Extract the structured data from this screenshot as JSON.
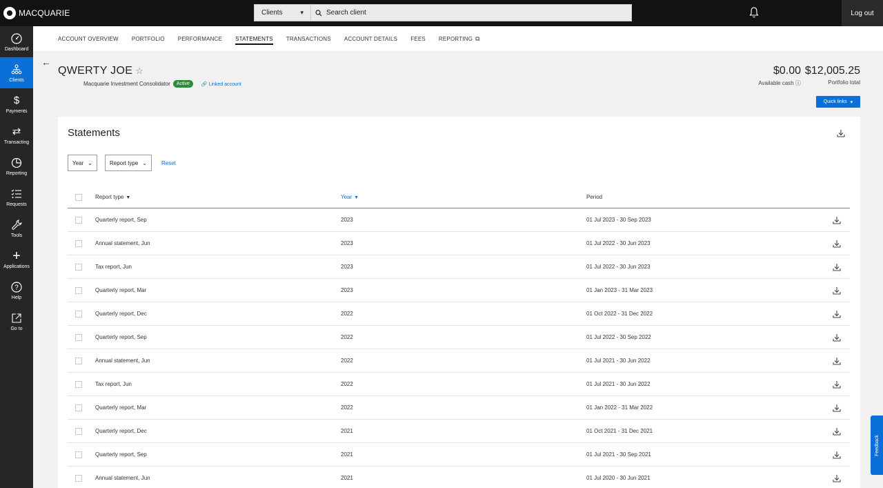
{
  "brand": {
    "name": "MACQUARIE"
  },
  "search": {
    "scope": "Clients",
    "placeholder": "Search client"
  },
  "top": {
    "logout": "Log out"
  },
  "sidenav": [
    {
      "label": "Dashboard",
      "icon": "dashboard-icon",
      "active": false
    },
    {
      "label": "Clients",
      "icon": "clients-icon",
      "active": true
    },
    {
      "label": "Payments",
      "icon": "dollar-icon",
      "active": false
    },
    {
      "label": "Transacting",
      "icon": "transfer-icon",
      "active": false
    },
    {
      "label": "Reporting",
      "icon": "pie-chart-icon",
      "active": false
    },
    {
      "label": "Requests",
      "icon": "checklist-icon",
      "active": false
    },
    {
      "label": "Tools",
      "icon": "wrench-icon",
      "active": false
    },
    {
      "label": "Applications",
      "icon": "plus-icon",
      "active": false
    },
    {
      "label": "Help",
      "icon": "help-icon",
      "active": false
    },
    {
      "label": "Go to",
      "icon": "external-link-icon",
      "active": false
    }
  ],
  "tabs": [
    {
      "label": "ACCOUNT OVERVIEW",
      "active": false
    },
    {
      "label": "PORTFOLIO",
      "active": false
    },
    {
      "label": "PERFORMANCE",
      "active": false
    },
    {
      "label": "STATEMENTS",
      "active": true
    },
    {
      "label": "TRANSACTIONS",
      "active": false
    },
    {
      "label": "ACCOUNT DETAILS",
      "active": false
    },
    {
      "label": "FEES",
      "active": false
    },
    {
      "label": "REPORTING",
      "active": false
    }
  ],
  "client": {
    "name": "QWERTY JOE",
    "product": "Macquarie Investment Consolidator",
    "status": "Active",
    "linked": "Linked account",
    "available_cash": "$0.00",
    "available_cash_label": "Available cash",
    "portfolio_total": "$12,005.25",
    "portfolio_total_label": "Portfolio total",
    "quick_links": "Quick links"
  },
  "statements": {
    "title": "Statements",
    "filters": {
      "year": "Year",
      "report_type": "Report type",
      "reset": "Reset"
    },
    "columns": {
      "type": "Report type",
      "year": "Year",
      "period": "Period"
    },
    "rows": [
      {
        "type": "Quarterly report, Sep",
        "year": "2023",
        "period": "01 Jul 2023 - 30 Sep 2023"
      },
      {
        "type": "Annual statement, Jun",
        "year": "2023",
        "period": "01 Jul 2022 - 30 Jun 2023"
      },
      {
        "type": "Tax report, Jun",
        "year": "2023",
        "period": "01 Jul 2022 - 30 Jun 2023"
      },
      {
        "type": "Quarterly report, Mar",
        "year": "2023",
        "period": "01 Jan 2023 - 31 Mar 2023"
      },
      {
        "type": "Quarterly report, Dec",
        "year": "2022",
        "period": "01 Oct 2022 - 31 Dec 2022"
      },
      {
        "type": "Quarterly report, Sep",
        "year": "2022",
        "period": "01 Jul 2022 - 30 Sep 2022"
      },
      {
        "type": "Annual statement, Jun",
        "year": "2022",
        "period": "01 Jul 2021 - 30 Jun 2022"
      },
      {
        "type": "Tax report, Jun",
        "year": "2022",
        "period": "01 Jul 2021 - 30 Jun 2022"
      },
      {
        "type": "Quarterly report, Mar",
        "year": "2022",
        "period": "01 Jan 2022 - 31 Mar 2022"
      },
      {
        "type": "Quarterly report, Dec",
        "year": "2021",
        "period": "01 Oct 2021 - 31 Dec 2021"
      },
      {
        "type": "Quarterly report, Sep",
        "year": "2021",
        "period": "01 Jul 2021 - 30 Sep 2021"
      },
      {
        "type": "Annual statement, Jun",
        "year": "2021",
        "period": "01 Jul 2020 - 30 Jun 2021"
      }
    ]
  },
  "feedback": "Feedback",
  "colors": {
    "accent": "#0b6fd8",
    "topbar": "#121212",
    "sidenav": "#262626",
    "active_badge": "#2e8b3c"
  }
}
